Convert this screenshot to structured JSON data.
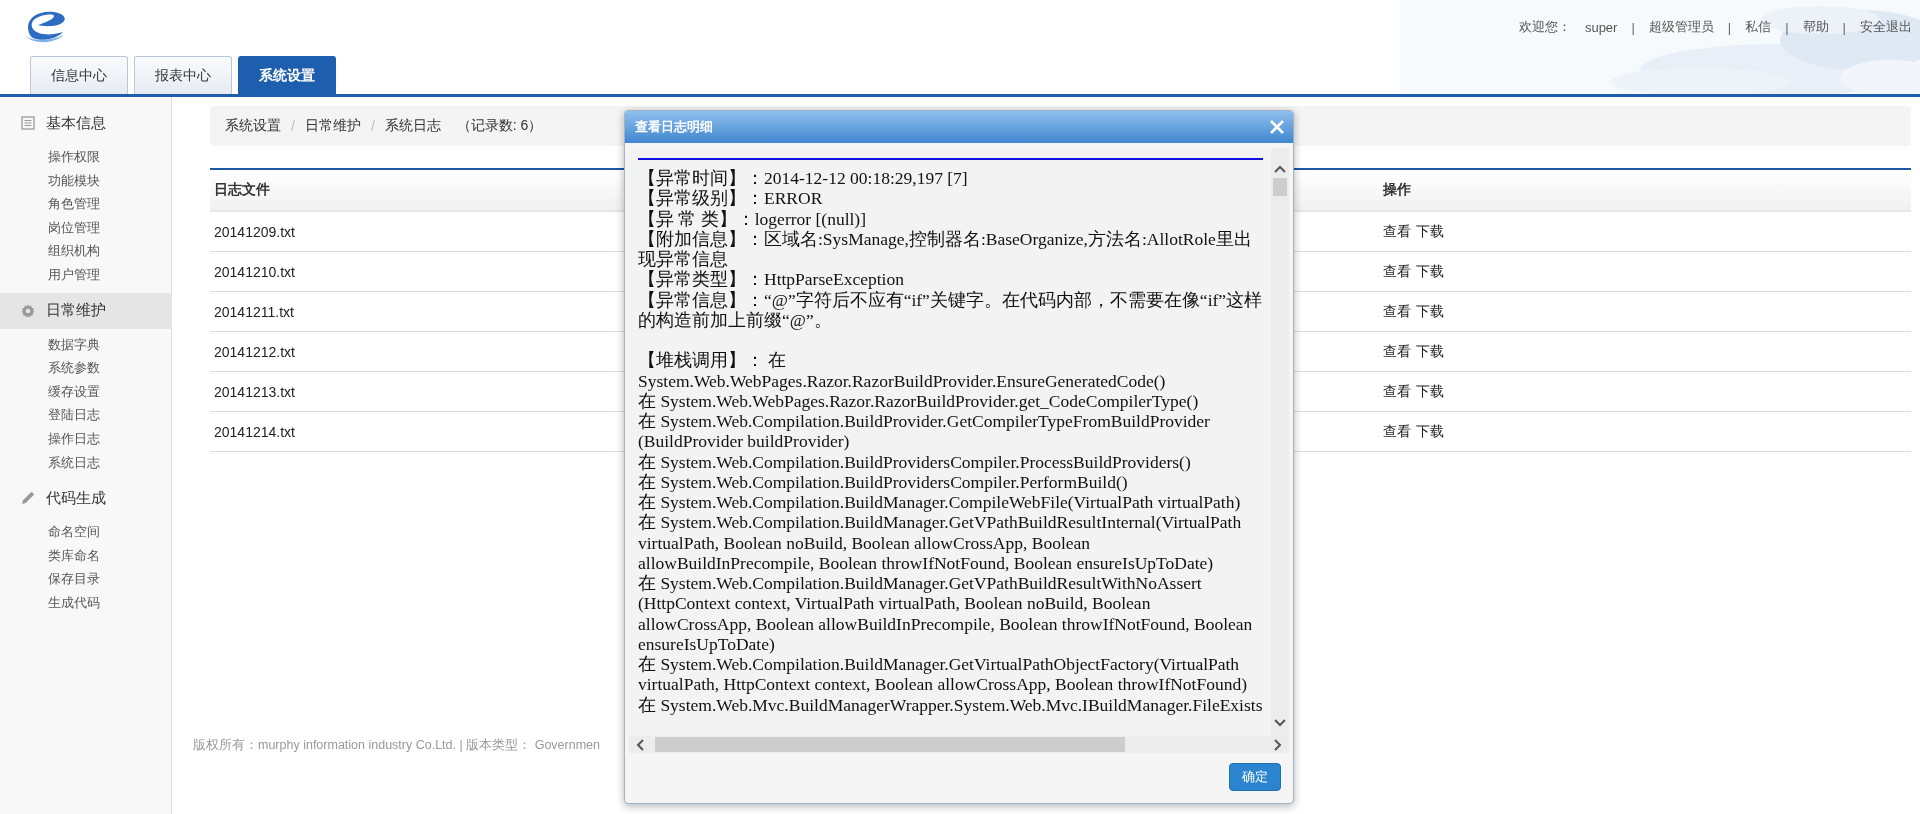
{
  "header": {
    "user_links": [
      {
        "kind": "text",
        "label": "欢迎您："
      },
      {
        "kind": "link",
        "label": "super"
      },
      {
        "kind": "separator",
        "label": "|"
      },
      {
        "kind": "link",
        "label": "超级管理员"
      },
      {
        "kind": "separator",
        "label": "|"
      },
      {
        "kind": "link",
        "label": "私信"
      },
      {
        "kind": "separator",
        "label": "|"
      },
      {
        "kind": "link",
        "label": "帮助"
      },
      {
        "kind": "separator",
        "label": "|"
      },
      {
        "kind": "link",
        "label": "安全退出"
      }
    ]
  },
  "tabs": [
    {
      "label": "信息中心",
      "selected": false
    },
    {
      "label": "报表中心",
      "selected": false
    },
    {
      "label": "系统设置",
      "selected": true
    }
  ],
  "sidebar": {
    "groups": [
      {
        "label": "基本信息",
        "selected": false,
        "items": [
          "操作权限",
          "功能模块",
          "角色管理",
          "岗位管理",
          "组织机构",
          "用户管理"
        ]
      },
      {
        "label": "日常维护",
        "selected": true,
        "items": [
          "数据字典",
          "系统参数",
          "缓存设置",
          "登陆日志",
          "操作日志",
          "系统日志"
        ]
      },
      {
        "label": "代码生成",
        "selected": false,
        "items": [
          "命名空间",
          "类库命名",
          "保存目录",
          "生成代码"
        ]
      }
    ]
  },
  "breadcrumb": {
    "items": [
      {
        "kind": "link",
        "label": "系统设置"
      },
      {
        "kind": "separator",
        "label": "/"
      },
      {
        "kind": "link",
        "label": "日常维护"
      },
      {
        "kind": "separator",
        "label": "/"
      },
      {
        "kind": "text",
        "label": "系统日志"
      }
    ],
    "count": "（记录数: 6）"
  },
  "table": {
    "columns": [
      "日志文件",
      "操作"
    ],
    "rows": [
      {
        "file": "20141209.txt",
        "actions": [
          "查看",
          "下载"
        ]
      },
      {
        "file": "20141210.txt",
        "actions": [
          "查看",
          "下载"
        ]
      },
      {
        "file": "20141211.txt",
        "actions": [
          "查看",
          "下载"
        ]
      },
      {
        "file": "20141212.txt",
        "actions": [
          "查看",
          "下载"
        ]
      },
      {
        "file": "20141213.txt",
        "actions": [
          "查看",
          "下载"
        ]
      },
      {
        "file": "20141214.txt",
        "actions": [
          "查看",
          "下载"
        ]
      }
    ]
  },
  "footer": "版权所有：murphy information industry Co.Ltd. | 版本类型： Governmen",
  "dialog": {
    "title": "查看日志明细",
    "fields": [
      "【异常时间】：2014-12-12 00:18:29,197 [7]",
      "【异常级别】：ERROR",
      "【异 常 类】：logerror [(null)]",
      "【附加信息】：区域名:SysManage,控制器名:BaseOrganize,方法名:AllotRole里出现异常信息",
      "【异常类型】：HttpParseException",
      "【异常信息】：“@”字符后不应有“if”关键字。在代码内部，不需要在像“if”这样的构造前加上前缀“@”。"
    ],
    "stack_trace": [
      "【堆栈调用】： 在 System.Web.WebPages.Razor.RazorBuildProvider.EnsureGeneratedCode()",
      "在 System.Web.WebPages.Razor.RazorBuildProvider.get_CodeCompilerType()",
      "在 System.Web.Compilation.BuildProvider.GetCompilerTypeFromBuildProvider (BuildProvider buildProvider)",
      "在 System.Web.Compilation.BuildProvidersCompiler.ProcessBuildProviders()",
      "在 System.Web.Compilation.BuildProvidersCompiler.PerformBuild()",
      "在 System.Web.Compilation.BuildManager.CompileWebFile(VirtualPath virtualPath)",
      "在 System.Web.Compilation.BuildManager.GetVPathBuildResultInternal(VirtualPath virtualPath, Boolean noBuild, Boolean allowCrossApp, Boolean allowBuildInPrecompile, Boolean throwIfNotFound, Boolean ensureIsUpToDate)",
      "在 System.Web.Compilation.BuildManager.GetVPathBuildResultWithNoAssert (HttpContext context, VirtualPath virtualPath, Boolean noBuild, Boolean allowCrossApp, Boolean allowBuildInPrecompile, Boolean throwIfNotFound, Boolean ensureIsUpToDate)",
      "在 System.Web.Compilation.BuildManager.GetVirtualPathObjectFactory(VirtualPath virtualPath, HttpContext context, Boolean allowCrossApp, Boolean throwIfNotFound)",
      "在 System.Web.Mvc.BuildManagerWrapper.System.Web.Mvc.IBuildManager.FileExists"
    ],
    "button": "确定"
  }
}
